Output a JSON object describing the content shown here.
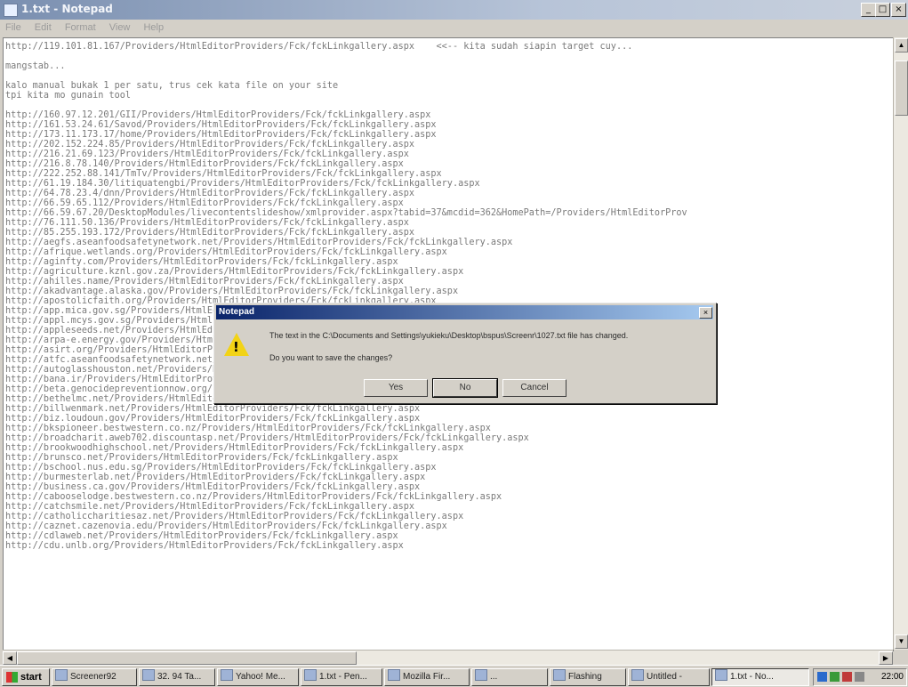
{
  "window": {
    "title": "1.txt - Notepad",
    "minimize": "_",
    "maximize": "□",
    "close": "×"
  },
  "menu": [
    "File",
    "Edit",
    "Format",
    "View",
    "Help"
  ],
  "editor_text": "http://119.101.81.167/Providers/HtmlEditorProviders/Fck/fckLinkgallery.aspx    <<-- kita sudah siapin target cuy...\n\nmangstab...\n\nkalo manual bukak 1 per satu, trus cek kata file on your site\ntpi kita mo gunain tool\n\nhttp://160.97.12.201/GII/Providers/HtmlEditorProviders/Fck/fckLinkgallery.aspx\nhttp://161.53.24.61/Savod/Providers/HtmlEditorProviders/Fck/fckLinkgallery.aspx\nhttp://173.11.173.17/home/Providers/HtmlEditorProviders/Fck/fckLinkgallery.aspx\nhttp://202.152.224.85/Providers/HtmlEditorProviders/Fck/fckLinkgallery.aspx\nhttp://216.21.69.123/Providers/HtmlEditorProviders/Fck/fckLinkgallery.aspx\nhttp://216.8.78.140/Providers/HtmlEditorProviders/Fck/fckLinkgallery.aspx\nhttp://222.252.88.141/TmTv/Providers/HtmlEditorProviders/Fck/fckLinkgallery.aspx\nhttp://61.19.184.30/litiquatengbi/Providers/HtmlEditorProviders/Fck/fckLinkgallery.aspx\nhttp://64.78.23.4/dnn/Providers/HtmlEditorProviders/Fck/fckLinkgallery.aspx\nhttp://66.59.65.112/Providers/HtmlEditorProviders/Fck/fckLinkgallery.aspx\nhttp://66.59.67.20/DesktopModules/livecontentslideshow/xmlprovider.aspx?tabid=37&mcdid=362&HomePath=/Providers/HtmlEditorProv\nhttp://76.111.50.136/Providers/HtmlEditorProviders/Fck/fckLinkgallery.aspx\nhttp://85.255.193.172/Providers/HtmlEditorProviders/Fck/fckLinkgallery.aspx\nhttp://aegfs.aseanfoodsafetynetwork.net/Providers/HtmlEditorProviders/Fck/fckLinkgallery.aspx\nhttp://afrique.wetlands.org/Providers/HtmlEditorProviders/Fck/fckLinkgallery.aspx\nhttp://aginfty.com/Providers/HtmlEditorProviders/Fck/fckLinkgallery.aspx\nhttp://agriculture.kznl.gov.za/Providers/HtmlEditorProviders/Fck/fckLinkgallery.aspx\nhttp://ahilles.name/Providers/HtmlEditorProviders/Fck/fckLinkgallery.aspx\nhttp://akadvantage.alaska.gov/Providers/HtmlEditorProviders/Fck/fckLinkgallery.aspx\nhttp://apostolicfaith.org/Providers/HtmlEditorProviders/Fck/fckLinkgallery.aspx\nhttp://app.mica.gov.sg/Providers/HtmlEditorProviders/Fck/fckLinkgallery.aspx\nhttp://appl.mcys.gov.sg/Providers/HtmlEditorProviders/Fck/fckLinkgallery.aspx\nhttp://appleseeds.net/Providers/HtmlEditorProviders/Fck/fckLinkgallery.aspx\nhttp://arpa-e.energy.gov/Providers/HtmlEditorProviders/Fck/fckLinkgallery.aspx\nhttp://asirt.org/Providers/HtmlEditorProviders/Fck/fckLinkgallery.aspx\nhttp://atfc.aseanfoodsafetynetwork.net/Providers/HtmlEditorProviders/Fck/fckLinkgallery.aspx\nhttp://autoglasshouston.net/Providers/HtmlEditorProviders/Fck/fckLinkgallery.aspx\nhttp://bana.ir/Providers/HtmlEditorProviders/Fck/fckLinkgallery.aspx\nhttp://beta.genocidepreventionnow.org/Providers/HtmlEditorProviders/Fck/fckLinkgallery.aspx\nhttp://bethelmc.net/Providers/HtmlEditorProviders/Fck/fckLinkgallery.aspx\nhttp://billwenmark.net/Providers/HtmlEditorProviders/Fck/fckLinkgallery.aspx\nhttp://biz.loudoun.gov/Providers/HtmlEditorProviders/Fck/fckLinkgallery.aspx\nhttp://bkspioneer.bestwestern.co.nz/Providers/HtmlEditorProviders/Fck/fckLinkgallery.aspx\nhttp://broadcharit.aweb702.discountasp.net/Providers/HtmlEditorProviders/Fck/fckLinkgallery.aspx\nhttp://brookwoodhighschool.net/Providers/HtmlEditorProviders/Fck/fckLinkgallery.aspx\nhttp://brunsco.net/Providers/HtmlEditorProviders/Fck/fckLinkgallery.aspx\nhttp://bschool.nus.edu.sg/Providers/HtmlEditorProviders/Fck/fckLinkgallery.aspx\nhttp://burmesterlab.net/Providers/HtmlEditorProviders/Fck/fckLinkgallery.aspx\nhttp://business.ca.gov/Providers/HtmlEditorProviders/Fck/fckLinkgallery.aspx\nhttp://cabooselodge.bestwestern.co.nz/Providers/HtmlEditorProviders/Fck/fckLinkgallery.aspx\nhttp://catchsmile.net/Providers/HtmlEditorProviders/Fck/fckLinkgallery.aspx\nhttp://catholiccharitiesaz.net/Providers/HtmlEditorProviders/Fck/fckLinkgallery.aspx\nhttp://caznet.cazenovia.edu/Providers/HtmlEditorProviders/Fck/fckLinkgallery.aspx\nhttp://cdlaweb.net/Providers/HtmlEditorProviders/Fck/fckLinkgallery.aspx\nhttp://cdu.unlb.org/Providers/HtmlEditorProviders/Fck/fckLinkgallery.aspx",
  "dialog": {
    "title": "Notepad",
    "close": "×",
    "icon": "warning-icon",
    "message": "The text in the C:\\Documents and Settings\\yukieku\\Desktop\\bspus\\Screenr\\1027.txt file has changed.",
    "question": "Do you want to save the changes?",
    "buttons": {
      "yes": "Yes",
      "no": "No",
      "cancel": "Cancel"
    }
  },
  "taskbar": {
    "start": "start",
    "tasks": [
      "Screener92",
      "32. 94 Ta...",
      "Yahoo! Me...",
      "1.txt - Pen...",
      "Mozilla Fir...",
      "...",
      "Flashing",
      "Untitled -",
      "1.txt - No..."
    ],
    "clock": "22:00"
  },
  "colors": {
    "dialog_title": "#0a246a",
    "window_title": "#7a8fb0",
    "warning": "#f2d316"
  }
}
